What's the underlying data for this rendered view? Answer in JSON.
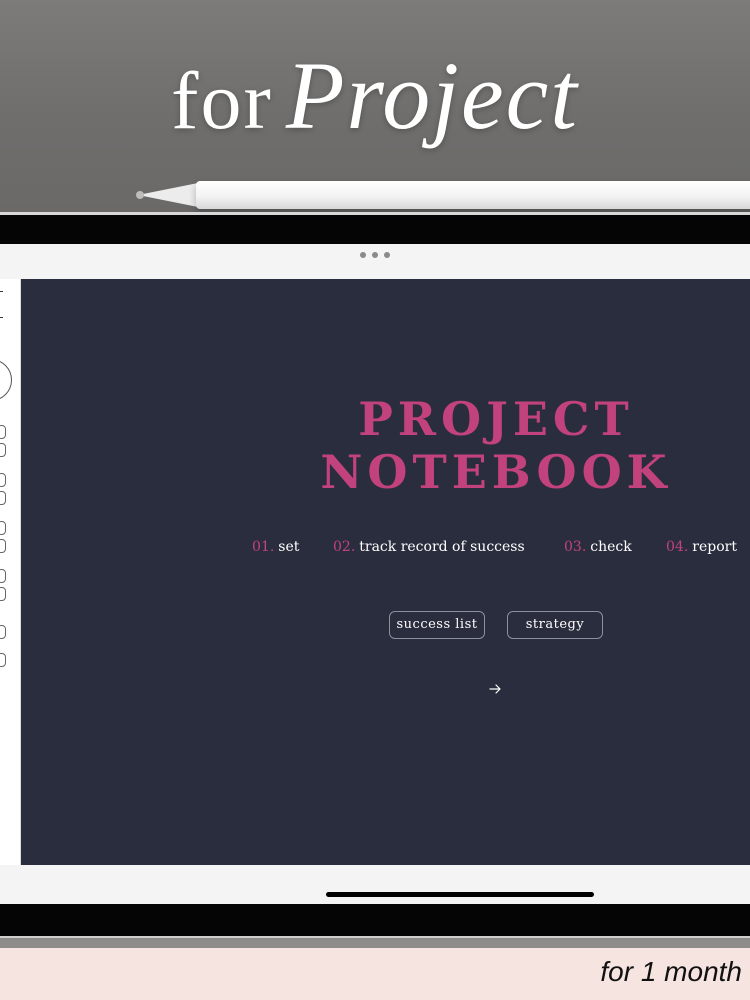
{
  "banner": {
    "headline_prefix": "for",
    "headline_main": "Project"
  },
  "page": {
    "title_line1": "PROJECT",
    "title_line2": "NOTEBOOK",
    "steps": [
      {
        "num": "01.",
        "label": "set"
      },
      {
        "num": "02.",
        "label": "track record of success"
      },
      {
        "num": "03.",
        "label": "check"
      },
      {
        "num": "04.",
        "label": "report"
      }
    ],
    "buttons": {
      "success_list": "success list",
      "strategy": "strategy"
    },
    "next_icon": "arrow-right-icon"
  },
  "footer": {
    "caption": "for 1 month"
  },
  "colors": {
    "page_bg": "#2a2d3d",
    "accent": "#c2427d",
    "footer_bg": "#f6e4e0"
  }
}
